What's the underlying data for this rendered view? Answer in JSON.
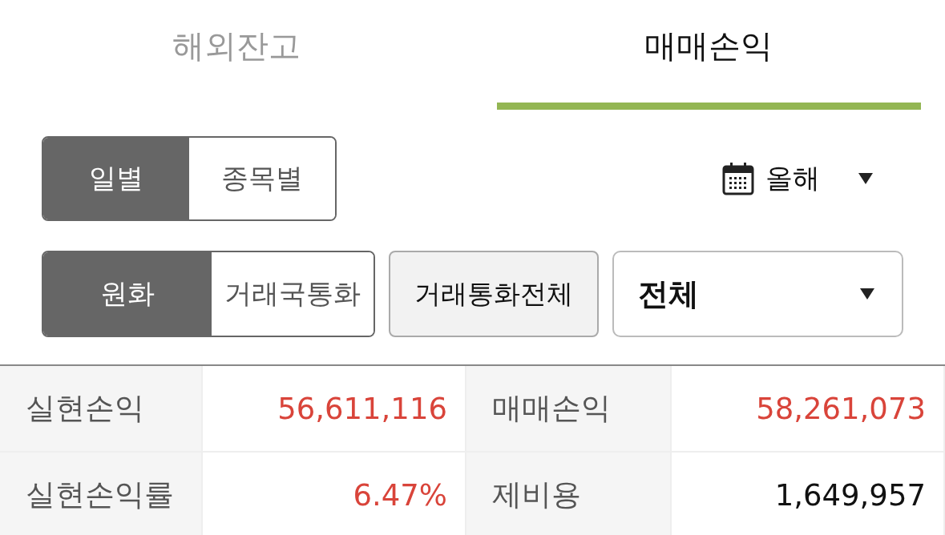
{
  "tabs": [
    {
      "label": "해외잔고",
      "selected": false
    },
    {
      "label": "매매손익",
      "selected": true
    }
  ],
  "view_toggle": [
    {
      "label": "일별",
      "selected": true
    },
    {
      "label": "종목별",
      "selected": false
    }
  ],
  "period": {
    "label": "올해"
  },
  "currency_toggle": [
    {
      "label": "원화",
      "selected": true
    },
    {
      "label": "거래국통화",
      "selected": false
    }
  ],
  "currency_button": {
    "label": "거래통화전체"
  },
  "filter_dropdown": {
    "value": "전체"
  },
  "summary": [
    [
      {
        "label": "실현손익",
        "value": "56,611,116",
        "color": "#d9443a"
      },
      {
        "label": "매매손익",
        "value": "58,261,073",
        "color": "#d9443a"
      }
    ],
    [
      {
        "label": "실현손익률",
        "value": "6.47%",
        "color": "#d9443a"
      },
      {
        "label": "제비용",
        "value": "1,649,957",
        "color": "#111111"
      }
    ]
  ]
}
